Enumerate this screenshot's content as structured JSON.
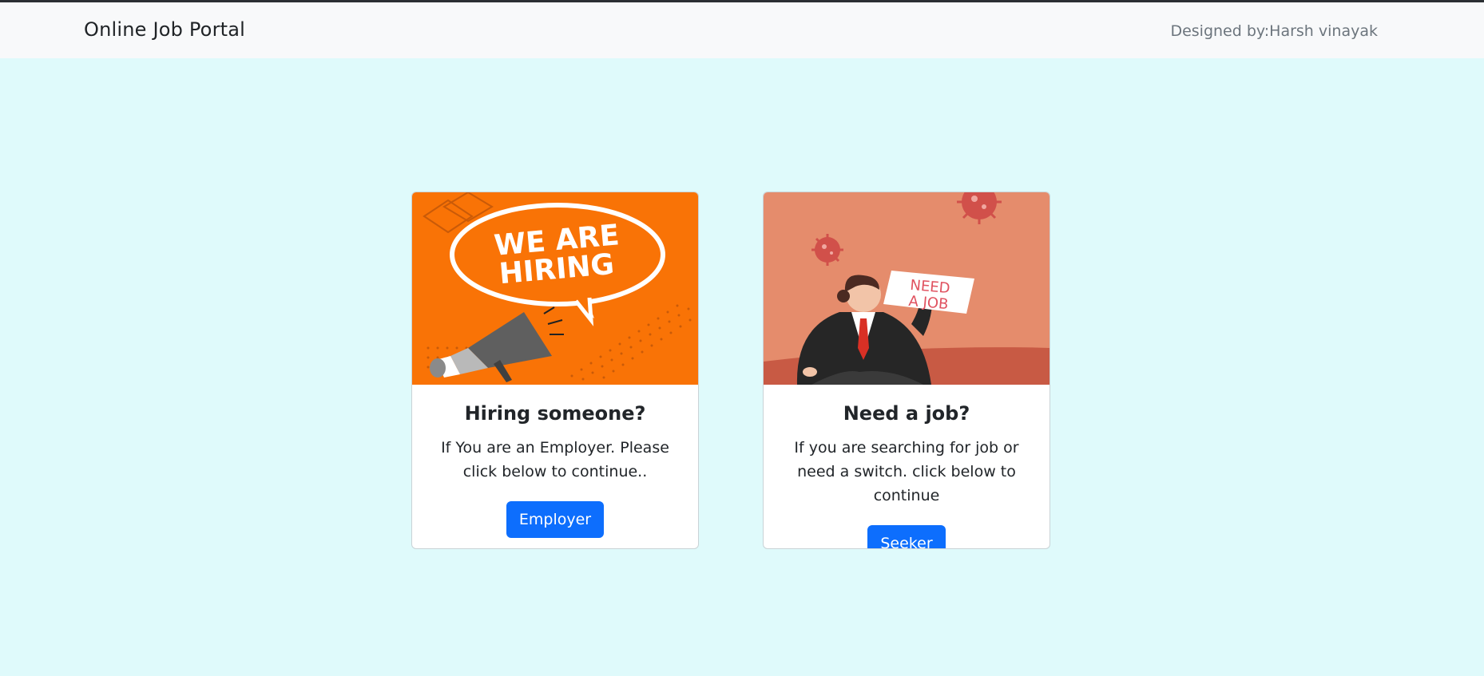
{
  "navbar": {
    "brand": "Online Job Portal",
    "credit": "Designed by:Harsh vinayak"
  },
  "cards": [
    {
      "image_text_line1": "WE ARE",
      "image_text_line2": "HIRING",
      "title": "Hiring someone?",
      "text": "If You are an Employer. Please click below to continue..",
      "button": "Employer"
    },
    {
      "image_text_line1": "NEED",
      "image_text_line2": "A JOB",
      "title": "Need a job?",
      "text": "If you are searching for job or need a switch. click below to continue",
      "button": "Seeker"
    }
  ],
  "colors": {
    "page_bg": "#dffafb",
    "navbar_bg": "#f8f9fa",
    "primary": "#0d6efd",
    "hiring_orange": "#f97306",
    "needjob_salmon": "#e58c6c"
  }
}
